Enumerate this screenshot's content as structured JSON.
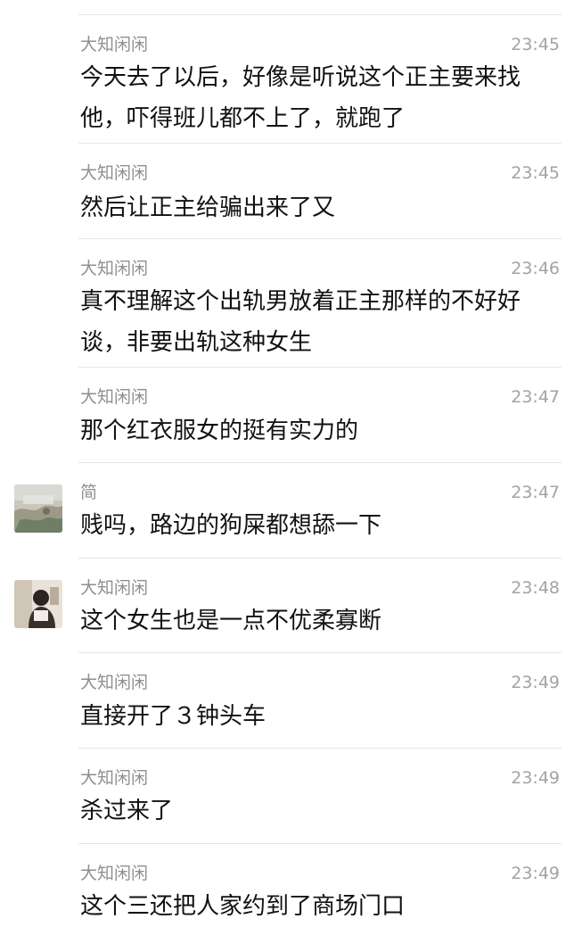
{
  "messages": [
    {
      "sender": "大知闲闲",
      "time": "23:45",
      "lines": [
        "今天去了以后，好像是听说这个正主要来找",
        "他，吓得班儿都不上了，就跑了"
      ]
    },
    {
      "sender": "大知闲闲",
      "time": "23:45",
      "lines": [
        "然后让正主给骗出来了又"
      ]
    },
    {
      "sender": "大知闲闲",
      "time": "23:46",
      "lines": [
        "真不理解这个出轨男放着正主那样的不好好",
        "谈，非要出轨这种女生"
      ]
    },
    {
      "sender": "大知闲闲",
      "time": "23:47",
      "lines": [
        "那个红衣服女的挺有实力的"
      ]
    },
    {
      "sender": "简",
      "time": "23:47",
      "lines": [
        "贱吗，路边的狗屎都想舔一下"
      ]
    },
    {
      "sender": "大知闲闲",
      "time": "23:48",
      "lines": [
        "这个女生也是一点不优柔寡断"
      ]
    },
    {
      "sender": "大知闲闲",
      "time": "23:49",
      "lines": [
        "直接开了３钟头车"
      ]
    },
    {
      "sender": "大知闲闲",
      "time": "23:49",
      "lines": [
        "杀过来了"
      ]
    },
    {
      "sender": "大知闲闲",
      "time": "23:49",
      "lines": [
        "这个三还把人家约到了商场门口"
      ]
    }
  ]
}
